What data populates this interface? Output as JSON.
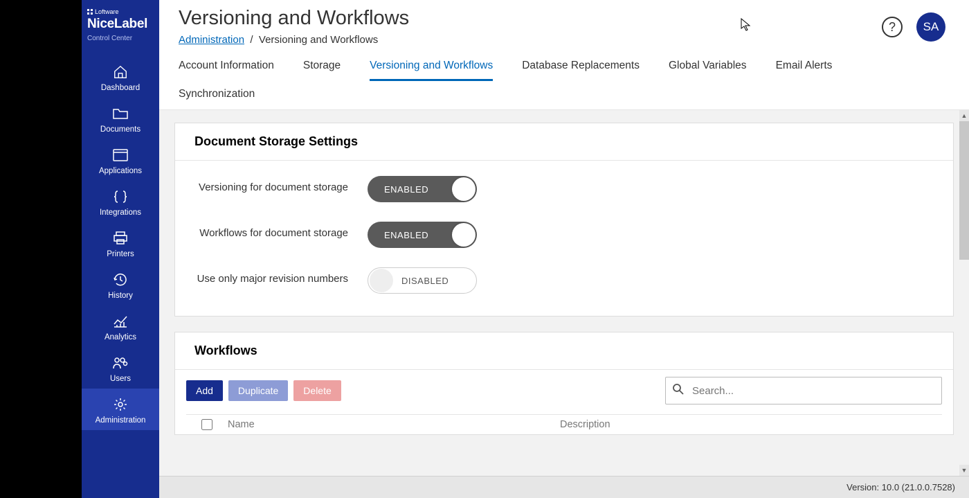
{
  "brand": {
    "top": "Loftware",
    "main": "NiceLabel",
    "sub": "Control Center"
  },
  "sidebar": {
    "items": [
      {
        "label": "Dashboard"
      },
      {
        "label": "Documents"
      },
      {
        "label": "Applications"
      },
      {
        "label": "Integrations"
      },
      {
        "label": "Printers"
      },
      {
        "label": "History"
      },
      {
        "label": "Analytics"
      },
      {
        "label": "Users"
      },
      {
        "label": "Administration"
      }
    ]
  },
  "header": {
    "title": "Versioning and Workflows",
    "breadcrumb_root": "Administration",
    "breadcrumb_current": "Versioning and Workflows",
    "avatar": "SA"
  },
  "tabs": [
    {
      "label": "Account Information"
    },
    {
      "label": "Storage"
    },
    {
      "label": "Versioning and Workflows"
    },
    {
      "label": "Database Replacements"
    },
    {
      "label": "Global Variables"
    },
    {
      "label": "Email Alerts"
    },
    {
      "label": "Synchronization"
    }
  ],
  "active_tab": "Versioning and Workflows",
  "panel1": {
    "title": "Document Storage Settings",
    "settings": [
      {
        "label": "Versioning for document storage",
        "state": "ENABLED",
        "on": true
      },
      {
        "label": "Workflows for document storage",
        "state": "ENABLED",
        "on": true
      },
      {
        "label": "Use only major revision numbers",
        "state": "DISABLED",
        "on": false
      }
    ]
  },
  "panel2": {
    "title": "Workflows",
    "buttons": {
      "add": "Add",
      "duplicate": "Duplicate",
      "delete": "Delete"
    },
    "search_placeholder": "Search...",
    "columns": {
      "name": "Name",
      "description": "Description"
    }
  },
  "footer": {
    "version": "Version: 10.0 (21.0.0.7528)"
  }
}
